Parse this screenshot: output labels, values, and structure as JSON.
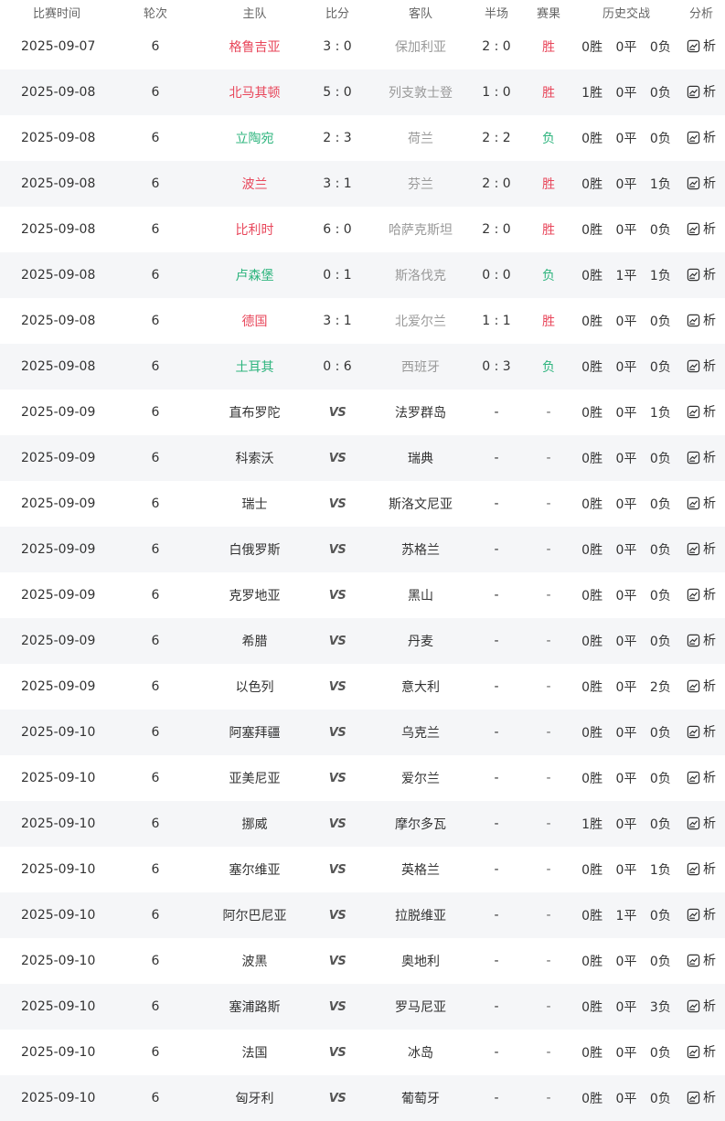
{
  "header": {
    "time": "比赛时间",
    "round": "轮次",
    "home": "主队",
    "score": "比分",
    "away": "客队",
    "half": "半场",
    "result": "赛果",
    "history": "历史交战",
    "analysis": "分析"
  },
  "colors": {
    "win": "#e8475b",
    "lose": "#2db47d",
    "row_alt": "#f5f6f8"
  },
  "history_labels": {
    "win": "胜",
    "draw": "平",
    "loss": "负"
  },
  "analysis_label": "析",
  "analysis_icon": "chart-document-icon",
  "vs_label": "VS",
  "rows": [
    {
      "date": "2025-09-07",
      "round": "6",
      "home": "格鲁吉亚",
      "home_style": "win",
      "score": "3 : 0",
      "away": "保加利亚",
      "half": "2 : 0",
      "result": "胜",
      "result_style": "win",
      "h_w": "0",
      "h_d": "0",
      "h_l": "0"
    },
    {
      "date": "2025-09-08",
      "round": "6",
      "home": "北马其顿",
      "home_style": "win",
      "score": "5 : 0",
      "away": "列支敦士登",
      "half": "1 : 0",
      "result": "胜",
      "result_style": "win",
      "h_w": "1",
      "h_d": "0",
      "h_l": "0"
    },
    {
      "date": "2025-09-08",
      "round": "6",
      "home": "立陶宛",
      "home_style": "lose",
      "score": "2 : 3",
      "away": "荷兰",
      "half": "2 : 2",
      "result": "负",
      "result_style": "lose",
      "h_w": "0",
      "h_d": "0",
      "h_l": "0"
    },
    {
      "date": "2025-09-08",
      "round": "6",
      "home": "波兰",
      "home_style": "win",
      "score": "3 : 1",
      "away": "芬兰",
      "half": "2 : 0",
      "result": "胜",
      "result_style": "win",
      "h_w": "0",
      "h_d": "0",
      "h_l": "1"
    },
    {
      "date": "2025-09-08",
      "round": "6",
      "home": "比利时",
      "home_style": "win",
      "score": "6 : 0",
      "away": "哈萨克斯坦",
      "half": "2 : 0",
      "result": "胜",
      "result_style": "win",
      "h_w": "0",
      "h_d": "0",
      "h_l": "0"
    },
    {
      "date": "2025-09-08",
      "round": "6",
      "home": "卢森堡",
      "home_style": "lose",
      "score": "0 : 1",
      "away": "斯洛伐克",
      "half": "0 : 0",
      "result": "负",
      "result_style": "lose",
      "h_w": "0",
      "h_d": "1",
      "h_l": "1"
    },
    {
      "date": "2025-09-08",
      "round": "6",
      "home": "德国",
      "home_style": "win",
      "score": "3 : 1",
      "away": "北爱尔兰",
      "half": "1 : 1",
      "result": "胜",
      "result_style": "win",
      "h_w": "0",
      "h_d": "0",
      "h_l": "0"
    },
    {
      "date": "2025-09-08",
      "round": "6",
      "home": "土耳其",
      "home_style": "lose",
      "score": "0 : 6",
      "away": "西班牙",
      "half": "0 : 3",
      "result": "负",
      "result_style": "lose",
      "h_w": "0",
      "h_d": "0",
      "h_l": "0"
    },
    {
      "date": "2025-09-09",
      "round": "6",
      "home": "直布罗陀",
      "home_style": "neutral",
      "score": "VS",
      "away": "法罗群岛",
      "half": "-",
      "result": "-",
      "result_style": "none",
      "h_w": "0",
      "h_d": "0",
      "h_l": "1"
    },
    {
      "date": "2025-09-09",
      "round": "6",
      "home": "科索沃",
      "home_style": "neutral",
      "score": "VS",
      "away": "瑞典",
      "half": "-",
      "result": "-",
      "result_style": "none",
      "h_w": "0",
      "h_d": "0",
      "h_l": "0"
    },
    {
      "date": "2025-09-09",
      "round": "6",
      "home": "瑞士",
      "home_style": "neutral",
      "score": "VS",
      "away": "斯洛文尼亚",
      "half": "-",
      "result": "-",
      "result_style": "none",
      "h_w": "0",
      "h_d": "0",
      "h_l": "0"
    },
    {
      "date": "2025-09-09",
      "round": "6",
      "home": "白俄罗斯",
      "home_style": "neutral",
      "score": "VS",
      "away": "苏格兰",
      "half": "-",
      "result": "-",
      "result_style": "none",
      "h_w": "0",
      "h_d": "0",
      "h_l": "0"
    },
    {
      "date": "2025-09-09",
      "round": "6",
      "home": "克罗地亚",
      "home_style": "neutral",
      "score": "VS",
      "away": "黑山",
      "half": "-",
      "result": "-",
      "result_style": "none",
      "h_w": "0",
      "h_d": "0",
      "h_l": "0"
    },
    {
      "date": "2025-09-09",
      "round": "6",
      "home": "希腊",
      "home_style": "neutral",
      "score": "VS",
      "away": "丹麦",
      "half": "-",
      "result": "-",
      "result_style": "none",
      "h_w": "0",
      "h_d": "0",
      "h_l": "0"
    },
    {
      "date": "2025-09-09",
      "round": "6",
      "home": "以色列",
      "home_style": "neutral",
      "score": "VS",
      "away": "意大利",
      "half": "-",
      "result": "-",
      "result_style": "none",
      "h_w": "0",
      "h_d": "0",
      "h_l": "2"
    },
    {
      "date": "2025-09-10",
      "round": "6",
      "home": "阿塞拜疆",
      "home_style": "neutral",
      "score": "VS",
      "away": "乌克兰",
      "half": "-",
      "result": "-",
      "result_style": "none",
      "h_w": "0",
      "h_d": "0",
      "h_l": "0"
    },
    {
      "date": "2025-09-10",
      "round": "6",
      "home": "亚美尼亚",
      "home_style": "neutral",
      "score": "VS",
      "away": "爱尔兰",
      "half": "-",
      "result": "-",
      "result_style": "none",
      "h_w": "0",
      "h_d": "0",
      "h_l": "0"
    },
    {
      "date": "2025-09-10",
      "round": "6",
      "home": "挪威",
      "home_style": "neutral",
      "score": "VS",
      "away": "摩尔多瓦",
      "half": "-",
      "result": "-",
      "result_style": "none",
      "h_w": "1",
      "h_d": "0",
      "h_l": "0"
    },
    {
      "date": "2025-09-10",
      "round": "6",
      "home": "塞尔维亚",
      "home_style": "neutral",
      "score": "VS",
      "away": "英格兰",
      "half": "-",
      "result": "-",
      "result_style": "none",
      "h_w": "0",
      "h_d": "0",
      "h_l": "1"
    },
    {
      "date": "2025-09-10",
      "round": "6",
      "home": "阿尔巴尼亚",
      "home_style": "neutral",
      "score": "VS",
      "away": "拉脱维亚",
      "half": "-",
      "result": "-",
      "result_style": "none",
      "h_w": "0",
      "h_d": "1",
      "h_l": "0"
    },
    {
      "date": "2025-09-10",
      "round": "6",
      "home": "波黑",
      "home_style": "neutral",
      "score": "VS",
      "away": "奥地利",
      "half": "-",
      "result": "-",
      "result_style": "none",
      "h_w": "0",
      "h_d": "0",
      "h_l": "0"
    },
    {
      "date": "2025-09-10",
      "round": "6",
      "home": "塞浦路斯",
      "home_style": "neutral",
      "score": "VS",
      "away": "罗马尼亚",
      "half": "-",
      "result": "-",
      "result_style": "none",
      "h_w": "0",
      "h_d": "0",
      "h_l": "3"
    },
    {
      "date": "2025-09-10",
      "round": "6",
      "home": "法国",
      "home_style": "neutral",
      "score": "VS",
      "away": "冰岛",
      "half": "-",
      "result": "-",
      "result_style": "none",
      "h_w": "0",
      "h_d": "0",
      "h_l": "0"
    },
    {
      "date": "2025-09-10",
      "round": "6",
      "home": "匈牙利",
      "home_style": "neutral",
      "score": "VS",
      "away": "葡萄牙",
      "half": "-",
      "result": "-",
      "result_style": "none",
      "h_w": "0",
      "h_d": "0",
      "h_l": "0"
    }
  ]
}
